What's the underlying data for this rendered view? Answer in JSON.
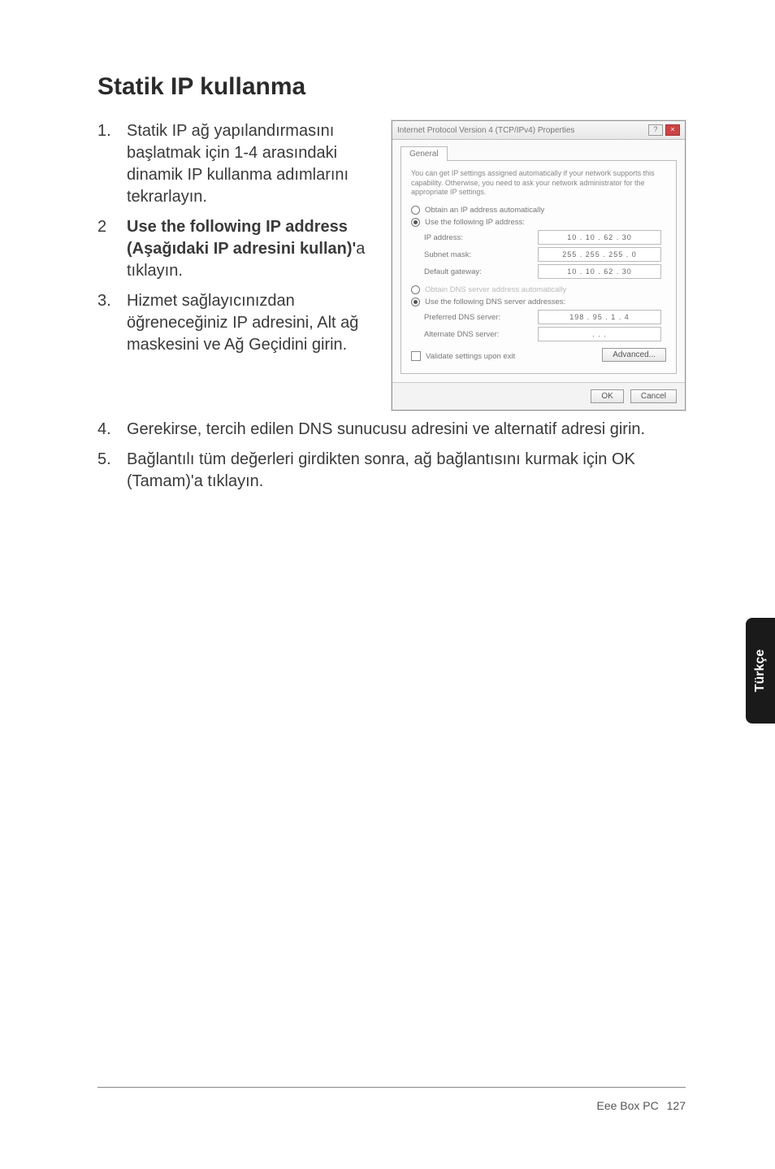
{
  "heading": "Statik IP kullanma",
  "steps_left": [
    {
      "num": "1.",
      "text": "Statik IP ağ yapılandırmasını başlatmak için 1-4 arasındaki dinamik IP kullanma adımlarını tekrarlayın."
    },
    {
      "num": "2",
      "bold": "Use the following IP address (Aşağıdaki IP adresini kullan)'",
      "tail": "a tıklayın."
    },
    {
      "num": "3.",
      "text": "Hizmet sağlayıcınızdan öğreneceğiniz IP adresini, Alt ağ maskesini ve Ağ Geçidini girin."
    }
  ],
  "steps_full": [
    {
      "num": "4.",
      "text": "Gerekirse, tercih edilen DNS sunucusu adresini ve alternatif adresi girin."
    },
    {
      "num": "5.",
      "text": "Bağlantılı tüm değerleri girdikten sonra, ağ bağlantısını kurmak için OK (Tamam)'a tıklayın."
    }
  ],
  "dialog": {
    "title": "Internet Protocol Version 4 (TCP/IPv4) Properties",
    "tab": "General",
    "desc": "You can get IP settings assigned automatically if your network supports this capability. Otherwise, you need to ask your network administrator for the appropriate IP settings.",
    "r_auto_ip": "Obtain an IP address automatically",
    "r_use_ip": "Use the following IP address:",
    "lbl_ip": "IP address:",
    "val_ip": "10 . 10 . 62 . 30",
    "lbl_mask": "Subnet mask:",
    "val_mask": "255 . 255 . 255 . 0",
    "lbl_gw": "Default gateway:",
    "val_gw": "10 . 10 . 62 . 30",
    "r_auto_dns": "Obtain DNS server address automatically",
    "r_use_dns": "Use the following DNS server addresses:",
    "lbl_pdns": "Preferred DNS server:",
    "val_pdns": "198 . 95 . 1 . 4",
    "lbl_adns": "Alternate DNS server:",
    "val_adns": ".     .     .",
    "chk_validate": "Validate settings upon exit",
    "btn_adv": "Advanced...",
    "btn_ok": "OK",
    "btn_cancel": "Cancel"
  },
  "side_tab": "Türkçe",
  "footer_text": "Eee Box PC",
  "footer_page": "127"
}
